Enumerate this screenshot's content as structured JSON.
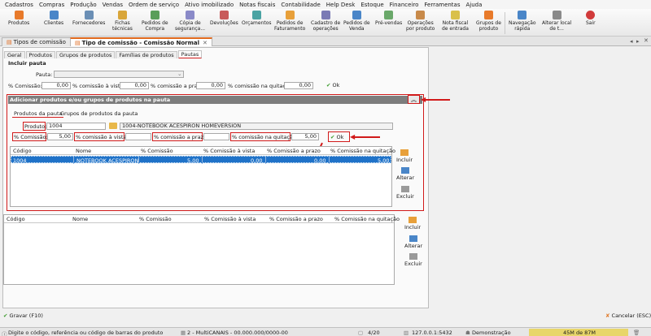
{
  "menu": [
    "Cadastros",
    "Compras",
    "Produção",
    "Vendas",
    "Ordem de serviço",
    "Ativo imobilizado",
    "Notas fiscais",
    "Contabilidade",
    "Help Desk",
    "Estoque",
    "Financeiro",
    "Ferramentas",
    "Ajuda"
  ],
  "toolbar": {
    "buttons": [
      {
        "l1": "Produtos",
        "l2": ""
      },
      {
        "l1": "Clientes",
        "l2": ""
      },
      {
        "l1": "Fornecedores",
        "l2": ""
      },
      {
        "l1": "Fichas",
        "l2": "técnicas"
      },
      {
        "l1": "Pedidos de",
        "l2": "Compra"
      },
      {
        "l1": "Cópia de",
        "l2": "segurança..."
      },
      {
        "l1": "Devoluções",
        "l2": ""
      },
      {
        "l1": "Orçamentos",
        "l2": ""
      },
      {
        "l1": "Pedidos de",
        "l2": "Faturamento"
      },
      {
        "l1": "Cadastro de",
        "l2": "operações"
      },
      {
        "l1": "Pedidos de",
        "l2": "Venda"
      },
      {
        "l1": "Pré-vendas",
        "l2": ""
      },
      {
        "l1": "Operações",
        "l2": "por produto"
      },
      {
        "l1": "Nota fiscal",
        "l2": "de entrada"
      },
      {
        "l1": "Grupos de",
        "l2": "produto"
      },
      {
        "l1": "Navegação",
        "l2": "rápida"
      },
      {
        "l1": "Alterar local",
        "l2": "de t..."
      },
      {
        "l1": "Sair",
        "l2": ""
      }
    ]
  },
  "window_tabs": [
    {
      "label": "Tipos de comissão"
    },
    {
      "label": "Tipo de comissão - Comissão Normal"
    }
  ],
  "inner_tabs": [
    "Geral",
    "Produtos",
    "Grupos de produtos",
    "Famílias de produtos",
    "Pautas"
  ],
  "pauta": {
    "title": "Incluir pauta",
    "pauta_label": "Pauta:",
    "pauta_value": "",
    "comissao_label": "% Comissão:",
    "comissao": "0,00",
    "vista_label": "% comissão à vista:",
    "vista": "0,00",
    "prazo_label": "% comissão a prazo:",
    "prazo": "0,00",
    "quitacao_label": "% comissão na quitação:",
    "quitacao": "0,00",
    "ok_label": "Ok"
  },
  "add_panel": {
    "title": "Adicionar produtos e/ou grupos de produtos na pauta",
    "tabs": [
      "Produtos da pauta",
      "Grupos de produtos da pauta"
    ],
    "produto_label": "Produto:",
    "produto_code": "1004",
    "produto_desc": "1004-NOTEBOOK ACESPIRON HOMEVERSION",
    "comissao_label": "% Comissão:",
    "comissao": "5,00",
    "vista_label": "% comissão à vista:",
    "vista": "",
    "prazo_label": "% comissão a prazo:",
    "prazo": "",
    "quitacao_label": "% comissão na quitação:",
    "quitacao": "5,00",
    "ok_label": "Ok"
  },
  "grid_columns": [
    "Código",
    "Nome",
    "% Comissão",
    "% Comissão à vista",
    "% Comissão a prazo",
    "% Comissão na quitação"
  ],
  "grid1_rows": [
    {
      "codigo": "1004",
      "nome": "NOTEBOOK ACESPIRON",
      "comissao": "5,00",
      "vista": "0,00",
      "prazo": "0,00",
      "quitacao": "5,00"
    }
  ],
  "side_buttons": [
    "Incluir",
    "Alterar",
    "Excluir"
  ],
  "bottom": {
    "gravar": "Gravar (F10)",
    "cancelar": "Cancelar (ESC)"
  },
  "status": {
    "hint": "Digite o código, referência ou código de barras do produto",
    "company": "2 - MultiCANAIS - 00.000.000/0000-00",
    "pages": "4/20",
    "server": "127.0.0.1:5432",
    "mode": "Demonstração",
    "memory": "45M de 87M"
  },
  "colors": {
    "accent": "#e06a1e",
    "highlight": "#d11a1a",
    "selection": "#1f72c8",
    "panel_header": "#7d7d7d"
  }
}
